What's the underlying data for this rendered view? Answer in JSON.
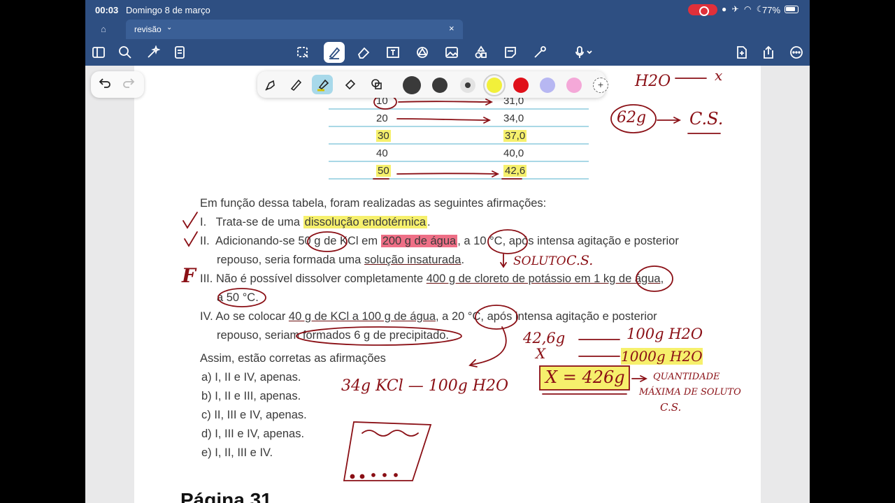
{
  "status": {
    "time": "00:03",
    "date": "Domingo 8 de março",
    "battery": "77%"
  },
  "tab": {
    "title": "revisão"
  },
  "icons": {
    "toolbar": [
      "sidebar-icon",
      "search-icon",
      "magic-icon",
      "document-icon",
      "lasso-icon",
      "pen-icon",
      "eraser-icon",
      "textbox-icon",
      "shapes-icon",
      "image-icon",
      "elements-icon",
      "sticky-note-icon",
      "laser-pointer-icon",
      "microphone-icon",
      "add-page-icon",
      "share-icon",
      "more-icon"
    ],
    "palette": [
      "fountain-pen-icon",
      "ballpoint-pen-icon",
      "highlighter-icon",
      "eraser-icon",
      "shapes-icon"
    ]
  },
  "palette": {
    "colors": [
      "#3a3a3a",
      "#3a3a3a",
      "#3a3a3a",
      "#f2f03a",
      "#e0101a",
      "#b7b7f2",
      "#f4a8d8"
    ],
    "add": "+"
  },
  "table": {
    "rows": [
      {
        "t": "10",
        "s": "31,0"
      },
      {
        "t": "20",
        "s": "34,0"
      },
      {
        "t": "30",
        "s": "37,0"
      },
      {
        "t": "40",
        "s": "40,0"
      },
      {
        "t": "50",
        "s": "42,6"
      }
    ]
  },
  "question": {
    "intro": "Em função dessa tabela, foram realizadas as seguintes afirmações:",
    "i_num": "I.",
    "i_a": "Trata-se de uma ",
    "i_b": "dissolução endotérmica",
    "i_c": ".",
    "ii_num": "II.",
    "ii_a": "Adicionando-se ",
    "ii_b": "50 g",
    "ii_c": " de KCl em ",
    "ii_d": "200 g de água",
    "ii_e": ", a 10 °C, após intensa agitação e posterior",
    "ii_f": "repouso, seria formada uma ",
    "ii_g": "solução insaturada",
    "ii_h": ".",
    "iii_num": "III.",
    "iii_a": "Não é possível dissolver completamente ",
    "iii_b": "400 g de cloreto de potássio em 1 kg de água,",
    "iii_c": "a 50 °C.",
    "iv_num": "IV.",
    "iv_a": "Ao se colocar ",
    "iv_b": "40 g de KCl a 100 g de água",
    "iv_c": ", a 20 °C, após intensa agitação e posterior",
    "iv_d": "repouso, seriam formados 6 g de precipitado.",
    "closing": "Assim, estão corretas as afirmações",
    "options": [
      "a) I, II e IV, apenas.",
      "b) I, II e III, apenas.",
      "c) II, III e IV, apenas.",
      "d) I, III e IV, apenas.",
      "e) I, II, III e IV."
    ],
    "next_heading": "Página 31"
  },
  "handwriting": {
    "h2o_top": "H2O",
    "arrow_x": "x",
    "g62": "62g",
    "cs1": "C.S.",
    "soluto": "SOLUTO",
    "cs2": "C.S.",
    "mark_f": "F",
    "m426": "42,6g",
    "g100": "100g H2O",
    "g1000": "1000g H2O",
    "x_mark": "X",
    "result": "X = 426g",
    "quant1": "QUANTIDADE",
    "quant2": "MÁXIMA DE SOLUTO",
    "cs3": "C.S.",
    "kcl": "34g KCl — 100g H2O"
  }
}
